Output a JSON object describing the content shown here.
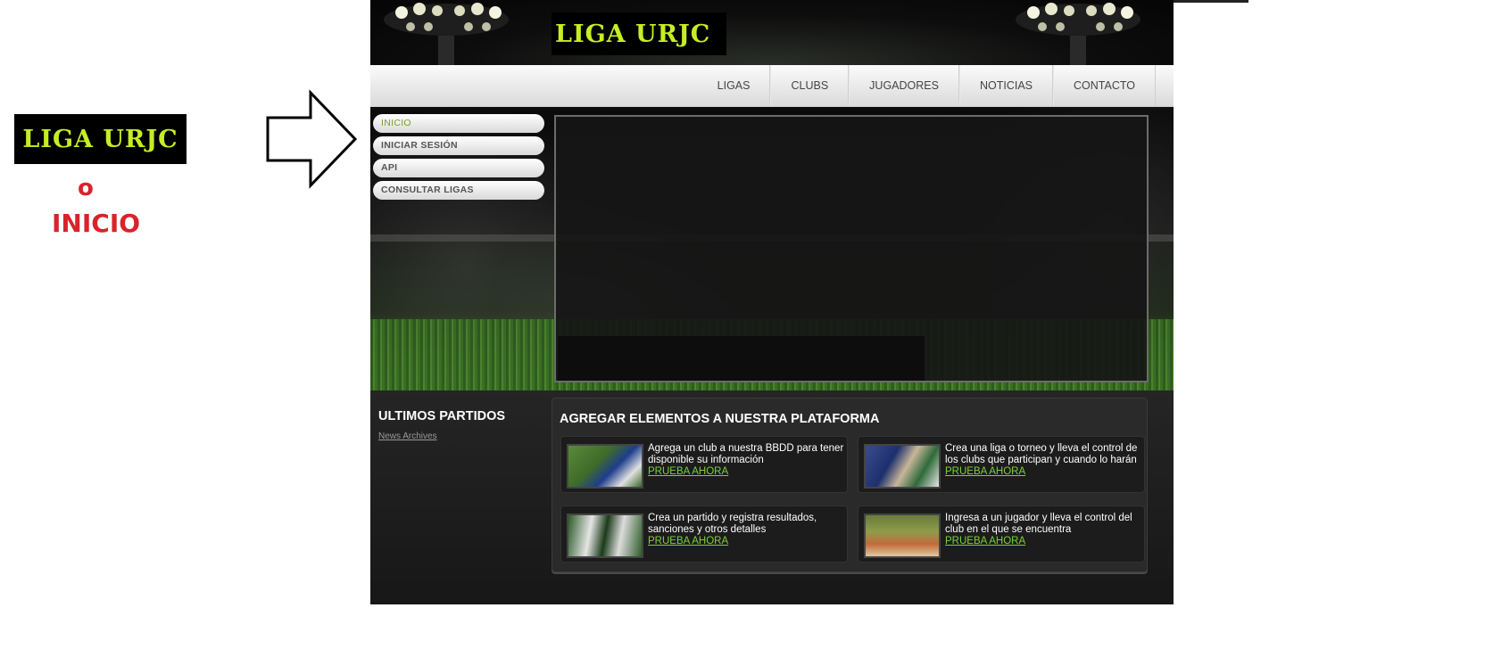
{
  "annotation": {
    "logo_text": "LIGA URJC",
    "or_text": "o",
    "inicio_text": "INICIO",
    "accent_color": "#d9232b"
  },
  "header": {
    "logo_text": "LIGA URJC",
    "logo_color": "#c6ee24"
  },
  "nav": {
    "items": [
      "LIGAS",
      "CLUBS",
      "JUGADORES",
      "NOTICIAS",
      "CONTACTO"
    ]
  },
  "sidebar": {
    "items": [
      {
        "label": "INICIO",
        "active": true
      },
      {
        "label": "INICIAR SESIÓN",
        "active": false
      },
      {
        "label": "API",
        "active": false
      },
      {
        "label": "CONSULTAR LIGAS",
        "active": false
      }
    ]
  },
  "latest": {
    "title": "ULTIMOS PARTIDOS",
    "archive_link": "News Archives"
  },
  "features": {
    "title": "AGREGAR ELEMENTOS A NUESTRA PLATAFORMA",
    "cta_color": "#7bd03c",
    "cards": [
      {
        "text": "Agrega un club a nuestra BBDD para tener disponible su información",
        "cta": "PRUEBA AHORA"
      },
      {
        "text": "Crea una liga o torneo y lleva el control de los clubs que participan y cuando lo harán",
        "cta": "PRUEBA AHORA"
      },
      {
        "text": "Crea un partido y registra resultados, sanciones y otros detalles",
        "cta": "PRUEBA AHORA"
      },
      {
        "text": "Ingresa a un jugador y lleva el control del club en el que se encuentra",
        "cta": "PRUEBA AHORA"
      }
    ]
  }
}
